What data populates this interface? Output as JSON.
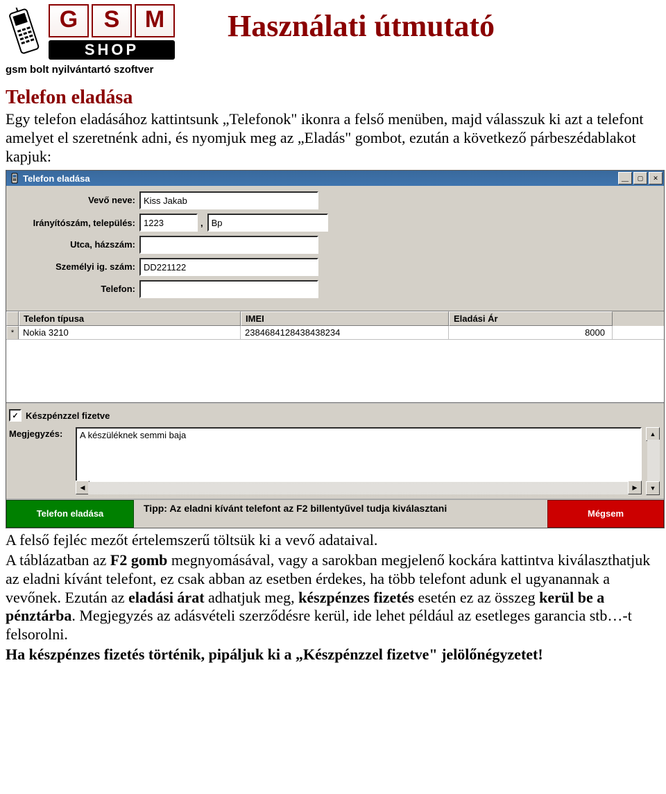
{
  "doc": {
    "title": "Használati útmutató",
    "logo": {
      "letters": [
        "G",
        "S",
        "M"
      ],
      "shop": "SHOP",
      "subtitle": "gsm bolt nyilvántartó szoftver"
    },
    "section_title": "Telefon eladása",
    "intro": "Egy telefon eladásához kattintsunk „Telefonok\" ikonra a felső menüben, majd válasszuk ki azt a telefont amelyet el szeretnénk adni, és nyomjuk meg az „Eladás\" gombot, ezután a következő párbeszédablakot kapjuk:",
    "p2": "A felső fejléc mezőt értelemszerű töltsük ki a vevő adataival.",
    "p3_a": "A táblázatban az ",
    "p3_b": "F2 gomb",
    "p3_c": " megnyomásával, vagy a sarokban megjelenő kockára kattintva kiválaszthatjuk az eladni kívánt telefont, ez csak abban az esetben érdekes, ha több telefont adunk el ugyanannak a vevőnek. Ezután az ",
    "p3_d": "eladási árat",
    "p3_e": " adhatjuk meg, ",
    "p3_f": "készpénzes fizetés",
    "p3_g": " esetén ez az összeg ",
    "p3_h": "kerül be a pénztárba",
    "p3_i": ". Megjegyzés az adásvételi szerződésre kerül, ide lehet például az esetleges garancia stb…-t felsorolni.",
    "p4": "Ha készpénzes fizetés történik, pipáljuk ki a „Készpénzzel fizetve\" jelölőnégyzetet!"
  },
  "dialog": {
    "title": "Telefon eladása",
    "labels": {
      "buyer": "Vevő neve:",
      "zipcity": "Irányítószám, település:",
      "street": "Utca, házszám:",
      "idnum": "Személyi ig. szám:",
      "phone": "Telefon:",
      "cash": "Készpénzzel fizetve",
      "note": "Megjegyzés:"
    },
    "values": {
      "buyer": "Kiss Jakab",
      "zip": "1223",
      "city": "Bp",
      "street": "",
      "idnum": "DD221122",
      "phone": "",
      "cash_checked": "✓",
      "note": "A készüléknek semmi baja"
    },
    "grid": {
      "headers": {
        "type": "Telefon típusa",
        "imei": "IMEI",
        "price": "Eladási Ár"
      },
      "rows": [
        {
          "marker": "*",
          "type": "Nokia 3210",
          "imei": "2384684128438438234",
          "price": "8000"
        }
      ]
    },
    "footer": {
      "sell": "Telefon eladása",
      "tip": "Tipp: Az eladni kívánt telefont az F2 billentyűvel tudja kiválasztani",
      "cancel": "Mégsem"
    }
  }
}
